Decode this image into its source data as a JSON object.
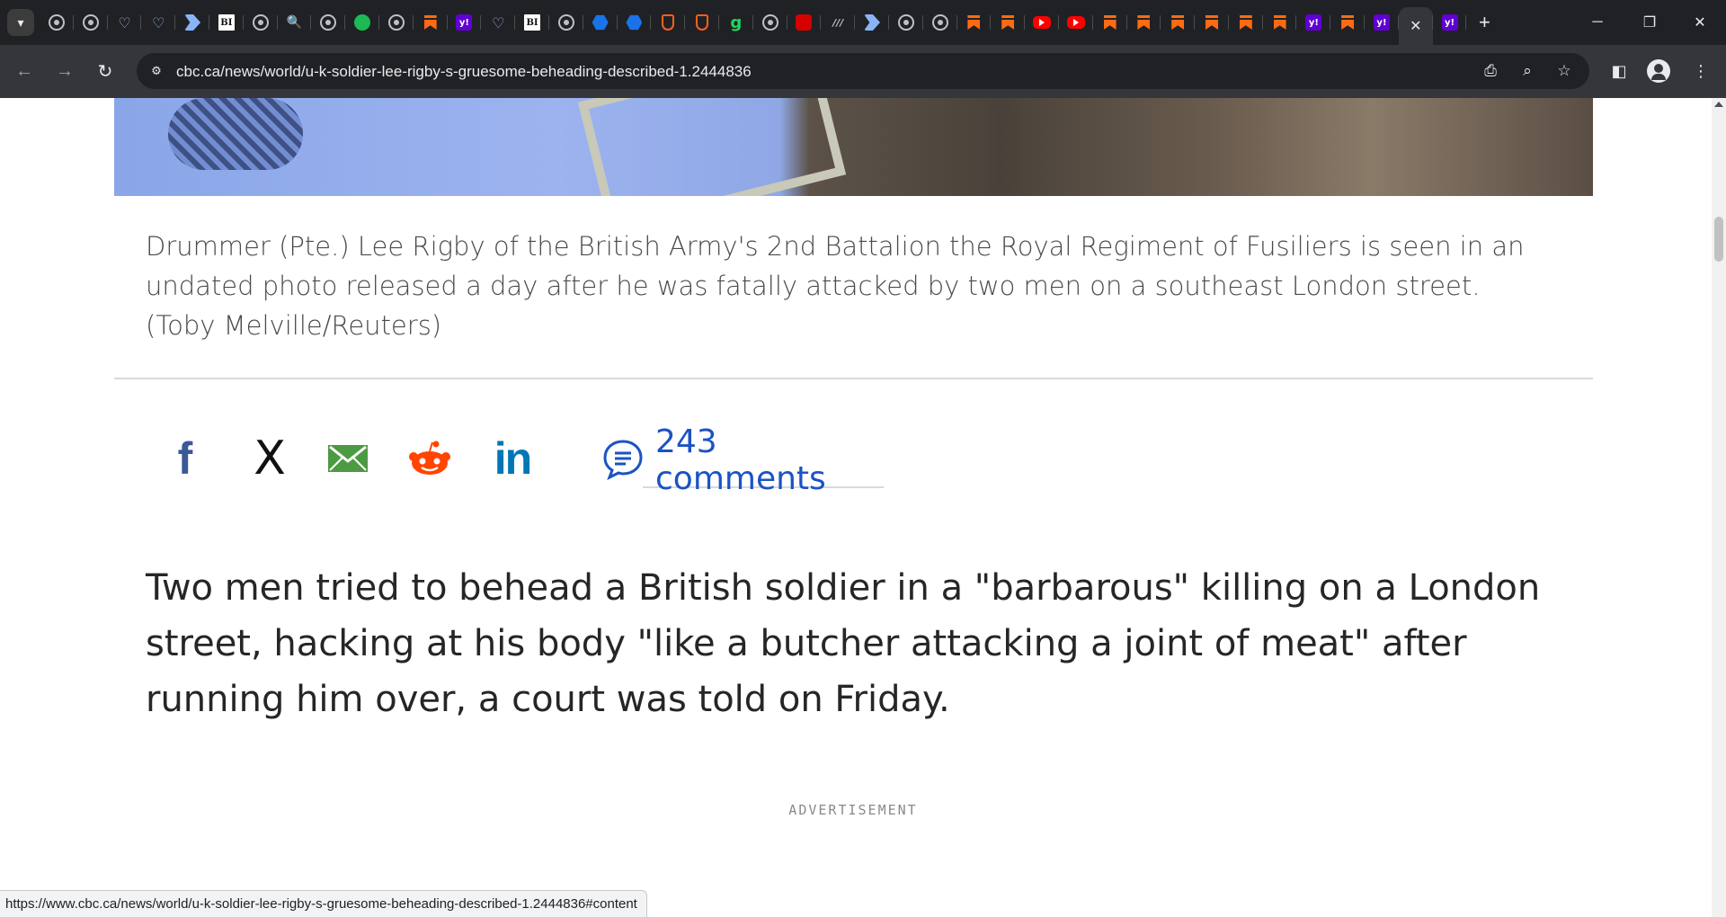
{
  "browser": {
    "url": "cbc.ca/news/world/u-k-soldier-lee-rigby-s-gruesome-beheading-described-1.2444836",
    "tabs": [
      {
        "icon": "globe-icon"
      },
      {
        "icon": "globe-icon"
      },
      {
        "icon": "heart-icon"
      },
      {
        "icon": "heart-icon"
      },
      {
        "icon": "arrow-icon"
      },
      {
        "icon": "business-insider-icon"
      },
      {
        "icon": "globe-icon"
      },
      {
        "icon": "search-icon"
      },
      {
        "icon": "globe-icon"
      },
      {
        "icon": "play-icon"
      },
      {
        "icon": "globe-icon"
      },
      {
        "icon": "bookmark-icon"
      },
      {
        "icon": "yahoo-icon"
      },
      {
        "icon": "heart-icon"
      },
      {
        "icon": "business-insider-icon"
      },
      {
        "icon": "globe-icon"
      },
      {
        "icon": "hex-icon"
      },
      {
        "icon": "hex-icon"
      },
      {
        "icon": "shield-icon"
      },
      {
        "icon": "shield-icon"
      },
      {
        "icon": "g-icon"
      },
      {
        "icon": "globe-icon"
      },
      {
        "icon": "red-app-icon"
      },
      {
        "icon": "italic-text-icon"
      },
      {
        "icon": "arrow-icon"
      },
      {
        "icon": "globe-icon"
      },
      {
        "icon": "globe-icon"
      },
      {
        "icon": "bookmark-icon"
      },
      {
        "icon": "bookmark-icon"
      },
      {
        "icon": "youtube-icon"
      },
      {
        "icon": "youtube-icon"
      },
      {
        "icon": "bookmark-icon"
      },
      {
        "icon": "bookmark-icon"
      },
      {
        "icon": "bookmark-icon"
      },
      {
        "icon": "bookmark-icon"
      },
      {
        "icon": "bookmark-icon"
      },
      {
        "icon": "bookmark-icon"
      },
      {
        "icon": "yahoo-icon"
      },
      {
        "icon": "bookmark-icon"
      },
      {
        "icon": "yahoo-icon"
      },
      {
        "icon": "close-icon",
        "active": true
      },
      {
        "icon": "yahoo-icon"
      }
    ],
    "fav_text": {
      "bi": "BI",
      "yahoo": "y!",
      "g": "g",
      "mono": "///",
      "search": "🔍",
      "heart": "♡"
    },
    "status_url": "https://www.cbc.ca/news/world/u-k-soldier-lee-rigby-s-gruesome-beheading-described-1.2444836#content"
  },
  "article": {
    "caption": "Drummer (Pte.) Lee Rigby of the British Army's 2nd Battalion the Royal Regiment of Fusiliers is seen in an undated photo released a day after he was fatally attacked by two men on a southeast London street. (Toby Melville/Reuters)",
    "share": {
      "facebook": "f",
      "x": "X",
      "linkedin": "in"
    },
    "comments_label": "243 comments",
    "lead": "Two men tried to behead a British soldier in a \"barbarous\" killing on a London street, hacking at his body \"like a butcher attacking a joint of meat\" after running him over, a court was told on Friday.",
    "advertisement_label": "ADVERTISEMENT"
  },
  "colors": {
    "chrome_dark": "#202124",
    "toolbar": "#35363a",
    "link_blue": "#1b53c4",
    "facebook": "#3b5998",
    "linkedin": "#0077b5",
    "mail": "#4c9a42",
    "reddit": "#ff4500"
  }
}
